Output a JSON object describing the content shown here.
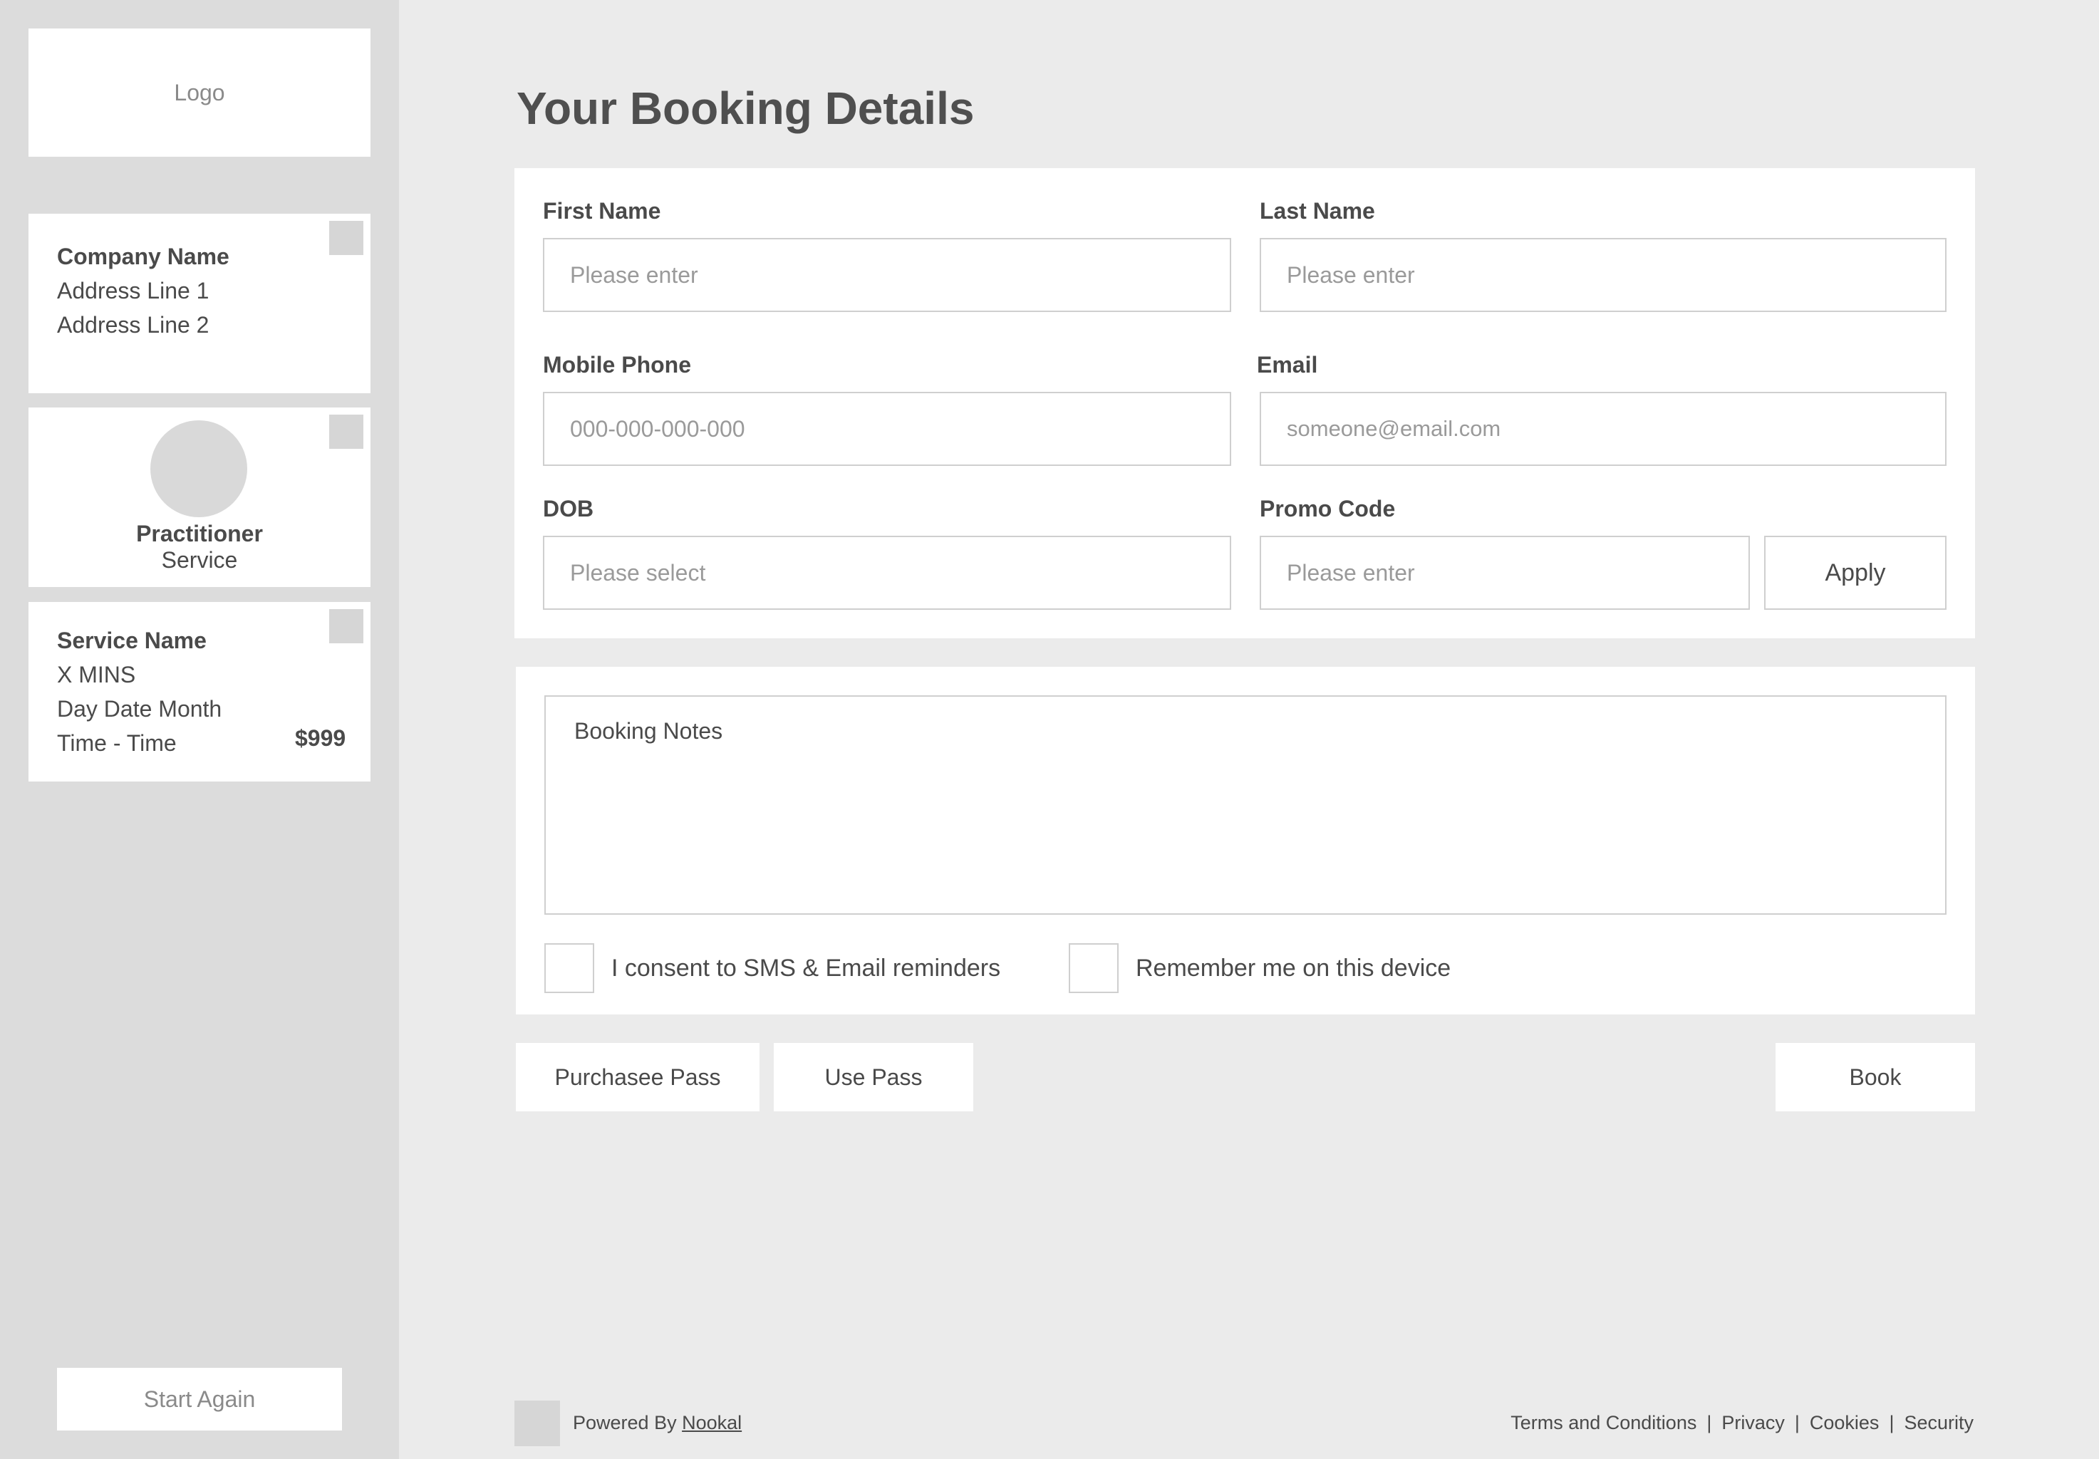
{
  "sidebar": {
    "logo": "Logo",
    "company": {
      "name": "Company Name",
      "address1": "Address Line 1",
      "address2": "Address Line 2"
    },
    "practitioner": {
      "name": "Practitioner",
      "service": "Service"
    },
    "service": {
      "name": "Service Name",
      "duration": "X MINS",
      "date": "Day Date Month",
      "time": "Time - Time",
      "price": "$999"
    },
    "start_again": "Start Again"
  },
  "main": {
    "title": "Your Booking Details",
    "form": {
      "first_name": {
        "label": "First Name",
        "placeholder": "Please enter"
      },
      "last_name": {
        "label": "Last Name",
        "placeholder": "Please enter"
      },
      "mobile": {
        "label": "Mobile Phone",
        "placeholder": "000-000-000-000"
      },
      "email": {
        "label": "Email",
        "placeholder": "someone@email.com"
      },
      "dob": {
        "label": "DOB",
        "placeholder": "Please select"
      },
      "promo": {
        "label": "Promo Code",
        "placeholder": "Please enter",
        "apply": "Apply"
      }
    },
    "notes": {
      "placeholder": "Booking Notes",
      "consent_label": "I consent to SMS & Email reminders",
      "remember_label": "Remember me on this device"
    },
    "actions": {
      "purchase_pass": "Purchasee Pass",
      "use_pass": "Use Pass",
      "book": "Book"
    }
  },
  "footer": {
    "powered_prefix": "Powered By",
    "powered_brand": "Nookal",
    "links": [
      "Terms and Conditions",
      "Privacy",
      "Cookies",
      "Security"
    ],
    "separator": "|"
  },
  "colors": {
    "sidebar_bg": "#dcdcdc",
    "page_bg": "#ebebeb",
    "text": "#4a4a4a",
    "border": "#cfcfcf"
  }
}
